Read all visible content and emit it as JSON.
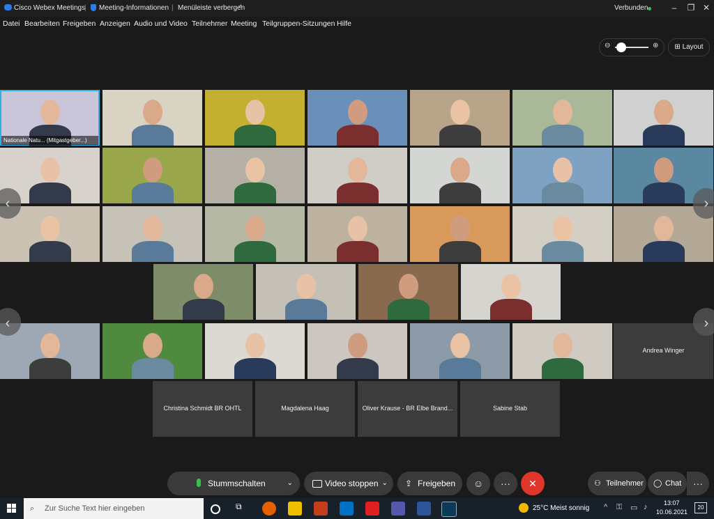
{
  "titlebar": {
    "app": "Cisco Webex Meetings",
    "info": "Meeting-Informationen",
    "hide_menu": "Menüleiste verbergen",
    "status": "Verbunden"
  },
  "menu": [
    "Datei",
    "Bearbeiten",
    "Freigeben",
    "Anzeigen",
    "Audio und Video",
    "Teilnehmer",
    "Meeting",
    "Teilgruppen-Sitzungen",
    "Hilfe"
  ],
  "layout_label": "Layout",
  "active_tile_label": "Nationale Natu... (Mitgastgeber...)",
  "name_tiles": {
    "andrea": "Andrea Winger",
    "christina": "Christina Schmidt BR OHTL",
    "magdalena": "Magdalena Haag",
    "oliver": "Oliver Krause - BR Elbe Brand...",
    "sabine": "Sabine Stab"
  },
  "controls": {
    "mute": "Stummschalten",
    "video": "Video stoppen",
    "share": "Freigeben",
    "participants": "Teilnehmer",
    "chat": "Chat"
  },
  "taskbar": {
    "search_placeholder": "Zur Suche Text hier eingeben",
    "weather": "25°C  Meist sonnig",
    "time": "13:07",
    "date": "10.06.2021",
    "notifications": "20"
  },
  "colors": {
    "accent": "#2fb0e6",
    "end_call": "#e0352b",
    "status_dot": "#3bbf4e"
  }
}
